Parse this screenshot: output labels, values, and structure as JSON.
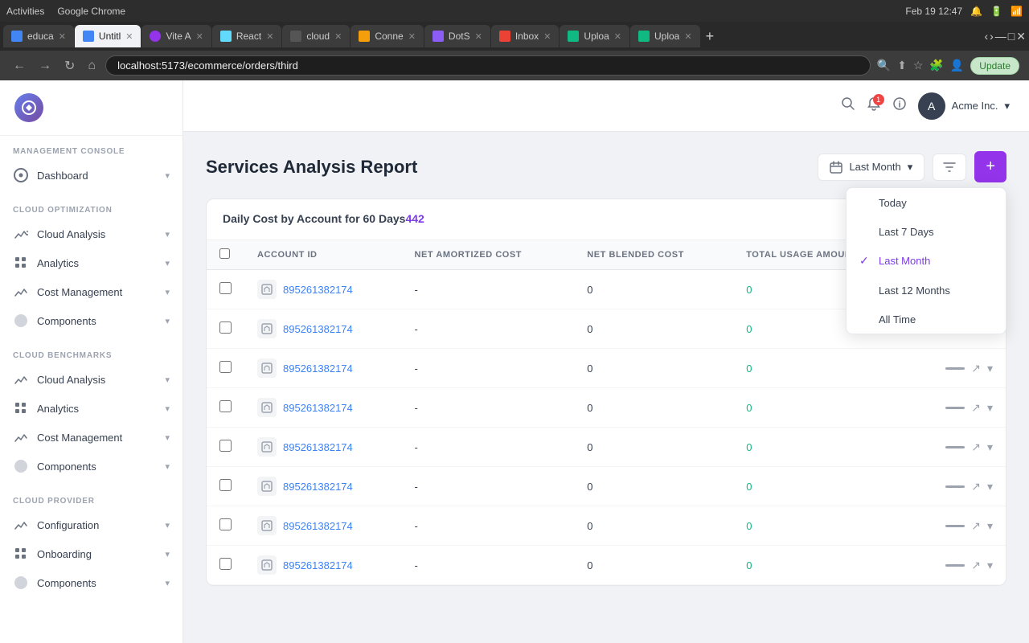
{
  "os": {
    "activities": "Activities",
    "browser_name": "Google Chrome",
    "datetime": "Feb 19  12:47"
  },
  "browser": {
    "tabs": [
      {
        "id": "educa",
        "label": "educa",
        "favicon_color": "#4285f4",
        "favicon_letter": "e",
        "active": false
      },
      {
        "id": "untitl",
        "label": "Untitl",
        "favicon_color": "#4285f4",
        "favicon_letter": "U",
        "active": true
      },
      {
        "id": "viteA",
        "label": "Vite A",
        "favicon_color": "#9333ea",
        "favicon_letter": "V",
        "active": false
      },
      {
        "id": "react",
        "label": "React",
        "favicon_color": "#61dafb",
        "favicon_letter": "R",
        "active": false
      },
      {
        "id": "cloud",
        "label": "cloud",
        "favicon_color": "#333",
        "favicon_letter": "c",
        "active": false
      },
      {
        "id": "conne",
        "label": "Conne",
        "favicon_color": "#f59e0b",
        "favicon_letter": "C",
        "active": false
      },
      {
        "id": "dots",
        "label": "DotS",
        "favicon_color": "#8b5cf6",
        "favicon_letter": "D",
        "active": false
      },
      {
        "id": "inbox",
        "label": "Inbox",
        "favicon_color": "#ea4335",
        "favicon_letter": "M",
        "active": false
      },
      {
        "id": "uploa1",
        "label": "Uploa",
        "favicon_color": "#10b981",
        "favicon_letter": "SB",
        "active": false
      },
      {
        "id": "uploa2",
        "label": "Uploa",
        "favicon_color": "#10b981",
        "favicon_letter": "SB",
        "active": false
      }
    ],
    "address": "localhost:5173/ecommerce/orders/third",
    "update_btn": "Update"
  },
  "sidebar": {
    "sections": [
      {
        "title": "MANAGEMENT CONSOLE",
        "items": [
          {
            "label": "Dashboard",
            "icon": "dashboard",
            "has_arrow": true
          }
        ]
      },
      {
        "title": "CLOUD OPTIMIZATION",
        "items": [
          {
            "label": "Cloud Analysis",
            "icon": "arrow",
            "has_arrow": true
          },
          {
            "label": "Analytics",
            "icon": "dots",
            "has_arrow": true
          },
          {
            "label": "Cost Management",
            "icon": "arrow",
            "has_arrow": true
          },
          {
            "label": "Components",
            "icon": "circle",
            "has_arrow": true
          }
        ]
      },
      {
        "title": "CLOUD BENCHMARKS",
        "items": [
          {
            "label": "Cloud Analysis",
            "icon": "arrow",
            "has_arrow": true
          },
          {
            "label": "Analytics",
            "icon": "dots",
            "has_arrow": true
          },
          {
            "label": "Cost Management",
            "icon": "arrow",
            "has_arrow": true
          },
          {
            "label": "Components",
            "icon": "circle",
            "has_arrow": true
          }
        ]
      },
      {
        "title": "CLOUD PROVIDER",
        "items": [
          {
            "label": "Configuration",
            "icon": "arrow",
            "has_arrow": true
          },
          {
            "label": "Onboarding",
            "icon": "dots",
            "has_arrow": true
          },
          {
            "label": "Components",
            "icon": "circle",
            "has_arrow": true
          }
        ]
      }
    ]
  },
  "top_nav": {
    "company": "Acme Inc.",
    "notification_count": "1"
  },
  "page": {
    "title": "Services Analysis Report",
    "table_title": "Daily Cost by Account for 60 Days",
    "table_count": "442",
    "date_label": "Last Month",
    "date_options": [
      {
        "label": "Today",
        "selected": false
      },
      {
        "label": "Last 7 Days",
        "selected": false
      },
      {
        "label": "Last Month",
        "selected": true
      },
      {
        "label": "Last 12 Months",
        "selected": false
      },
      {
        "label": "All Time",
        "selected": false
      }
    ],
    "table_columns": [
      "ACCOUNT ID",
      "NET AMORTIZED COST",
      "NET BLENDED COST",
      "TOTAL USAGE AMOUNT"
    ],
    "table_rows": [
      {
        "account_id": "895261382174",
        "net_amortized": "-",
        "net_blended": "0",
        "total_usage": "0"
      },
      {
        "account_id": "895261382174",
        "net_amortized": "-",
        "net_blended": "0",
        "total_usage": "0"
      },
      {
        "account_id": "895261382174",
        "net_amortized": "-",
        "net_blended": "0",
        "total_usage": "0"
      },
      {
        "account_id": "895261382174",
        "net_amortized": "-",
        "net_blended": "0",
        "total_usage": "0"
      },
      {
        "account_id": "895261382174",
        "net_amortized": "-",
        "net_blended": "0",
        "total_usage": "0"
      },
      {
        "account_id": "895261382174",
        "net_amortized": "-",
        "net_blended": "0",
        "total_usage": "0"
      },
      {
        "account_id": "895261382174",
        "net_amortized": "-",
        "net_blended": "0",
        "total_usage": "0"
      },
      {
        "account_id": "895261382174",
        "net_amortized": "-",
        "net_blended": "0",
        "total_usage": "0"
      }
    ]
  }
}
